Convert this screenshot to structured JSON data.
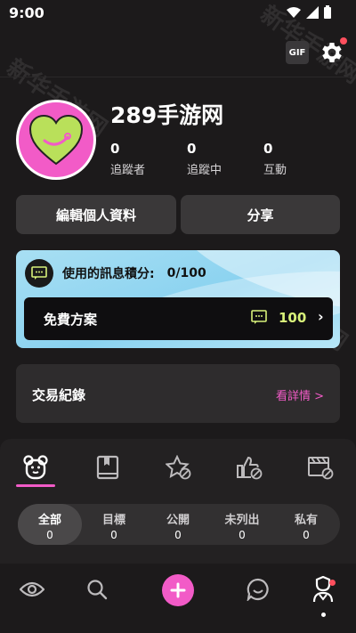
{
  "status_bar": {
    "time": "9:00"
  },
  "watermark": "新华手游网",
  "header": {
    "gif_label": "GIF"
  },
  "profile": {
    "username": "289手游网",
    "stats": [
      {
        "value": "0",
        "label": "追蹤者"
      },
      {
        "value": "0",
        "label": "追蹤中"
      },
      {
        "value": "0",
        "label": "互動"
      }
    ],
    "edit_button": "編輯個人資料",
    "share_button": "分享"
  },
  "credits": {
    "label": "使用的訊息積分:",
    "value": "0/100",
    "plan_name": "免費方案",
    "plan_count": "100"
  },
  "transactions": {
    "title": "交易紀錄",
    "link": "看詳情 >"
  },
  "category_tabs": [
    "bear-icon",
    "book-icon",
    "star-hidden-icon",
    "thumbs-up-hidden-icon",
    "clapper-hidden-icon"
  ],
  "filters": [
    {
      "label": "全部",
      "count": "0"
    },
    {
      "label": "目標",
      "count": "0"
    },
    {
      "label": "公開",
      "count": "0"
    },
    {
      "label": "未列出",
      "count": "0"
    },
    {
      "label": "私有",
      "count": "0"
    }
  ],
  "bottom_nav": [
    "eye-icon",
    "search-icon",
    "plus-icon",
    "chat-icon",
    "profile-icon"
  ],
  "colors": {
    "accent": "#f25bc7",
    "notification": "#ff4f5e",
    "credit_count": "#d8f27a"
  }
}
